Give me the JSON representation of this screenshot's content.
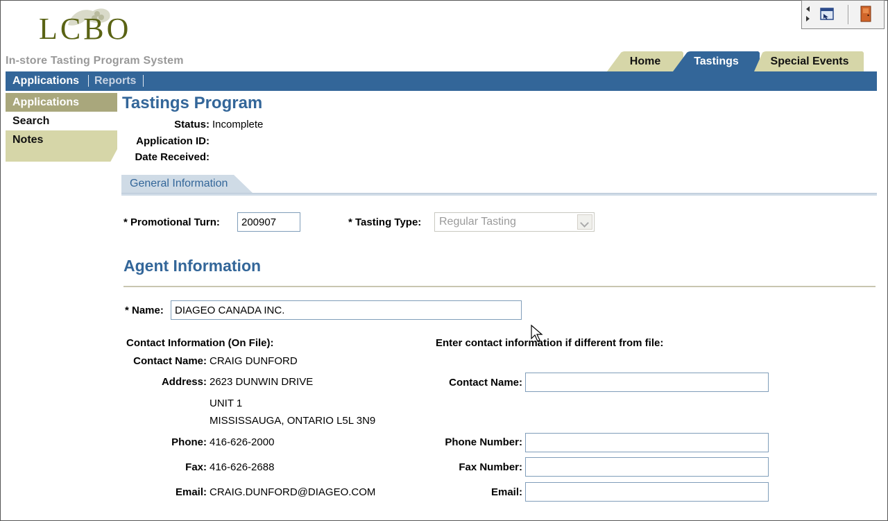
{
  "header": {
    "logo_text": "LCBO",
    "system_title": "In-store Tasting Program System",
    "util_icons": [
      "window-icon",
      "exit-door-icon"
    ]
  },
  "tabs": [
    {
      "label": "Home",
      "active": false
    },
    {
      "label": "Tastings",
      "active": true
    },
    {
      "label": "Special Events",
      "active": false
    }
  ],
  "navbar": {
    "items": [
      "Applications",
      "Reports"
    ],
    "separator": "|"
  },
  "leftnav": {
    "items": [
      {
        "label": "Applications",
        "state": "active"
      },
      {
        "label": "Search",
        "state": "plain"
      },
      {
        "label": "Notes",
        "state": "olive"
      }
    ]
  },
  "page": {
    "title": "Tastings Program",
    "status_label": "Status:",
    "status_value": "Incomplete",
    "app_id_label": "Application ID:",
    "app_id_value": "",
    "date_label": "Date Received:",
    "date_value": ""
  },
  "general": {
    "tab_label": "General Information",
    "promo_label": "* Promotional Turn:",
    "promo_value": "200907",
    "type_label": "* Tasting Type:",
    "type_value": "Regular Tasting"
  },
  "agent": {
    "title": "Agent Information",
    "name_label": "* Name:",
    "name_value": "DIAGEO CANADA INC.",
    "onfile_heading": "Contact Information (On File):",
    "different_heading": "Enter contact information if different from file:",
    "contact_name_label": "Contact Name:",
    "contact_name_value": "CRAIG DUNFORD",
    "address_label": "Address:",
    "address_line1": "2623 DUNWIN DRIVE",
    "address_line2": "UNIT 1",
    "address_line3": "MISSISSAUGA, ONTARIO L5L 3N9",
    "phone_label": "Phone:",
    "phone_value": "416-626-2000",
    "fax_label": "Fax:",
    "fax_value": "416-626-2688",
    "email_label": "Email:",
    "email_value": "CRAIG.DUNFORD@DIAGEO.COM",
    "alt_contact_label": "Contact Name:",
    "alt_phone_label": "Phone Number:",
    "alt_fax_label": "Fax Number:",
    "alt_email_label": "Email:"
  },
  "colors": {
    "brand_blue": "#336699",
    "olive": "#a9a77c",
    "olive_light": "#d6d6a8",
    "logo_green": "#5a6314"
  }
}
